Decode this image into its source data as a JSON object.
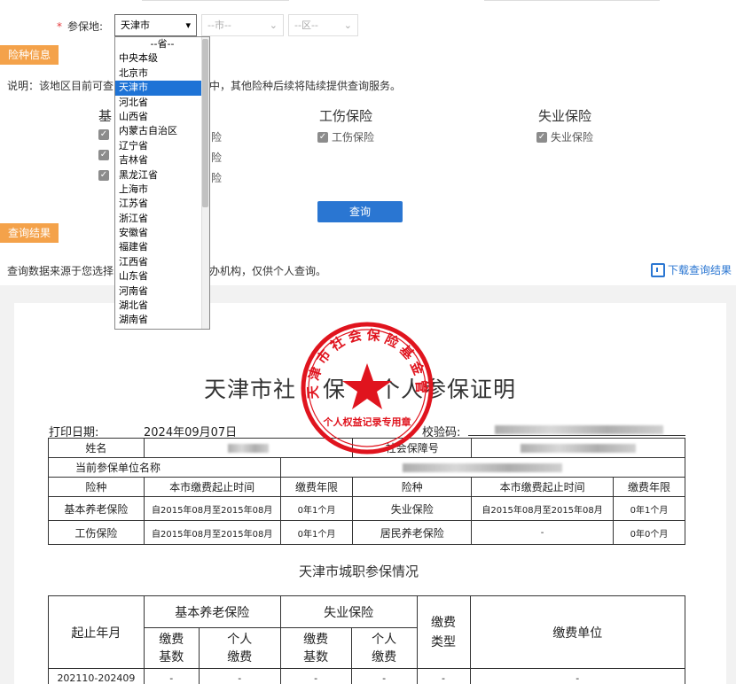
{
  "region": {
    "label": "参保地:",
    "required_mark": "*",
    "province_value": "天津市",
    "city_placeholder": "--市--",
    "district_placeholder": "--区--"
  },
  "province_options": [
    "--省--",
    "中央本级",
    "北京市",
    "天津市",
    "河北省",
    "山西省",
    "内蒙古自治区",
    "辽宁省",
    "吉林省",
    "黑龙江省",
    "上海市",
    "江苏省",
    "浙江省",
    "安徽省",
    "福建省",
    "江西省",
    "山东省",
    "河南省",
    "湖北省",
    "湖南省"
  ],
  "selected_option": "天津市",
  "insurance": {
    "tag": "险种信息",
    "note_prefix": "说明：该地区目前可查",
    "note_suffix": "中，其他险种后续将陆续提供查询服务。",
    "groups": [
      {
        "title": "基",
        "items": [
          "",
          "",
          ""
        ]
      },
      {
        "title": "工伤保险",
        "items": [
          "工伤保险"
        ]
      },
      {
        "title": "失业保险",
        "items": [
          "失业保险"
        ]
      }
    ],
    "partial_items": [
      "险",
      "险",
      "险"
    ],
    "query_button": "查询"
  },
  "result": {
    "tag": "查询结果",
    "note_prefix": "查询数据来源于您选择",
    "note_suffix": "办机构，仅供个人查询。",
    "download_label": "下载查询结果"
  },
  "certificate": {
    "title_a": "天津市社",
    "title_b": "保",
    "title_c": "个",
    "title_d": "人参保证明",
    "print_label": "打印日期:",
    "print_date": "2024年09月07日",
    "verify_label": "校验码:",
    "name_label": "姓名",
    "ssn_label": "社会保障号",
    "unit_label": "当前参保单位名称",
    "col_type": "险种",
    "col_period": "本市缴费起止时间",
    "col_years": "缴费年限",
    "rows": [
      {
        "type_a": "基本养老保险",
        "period_a": "自2015年08月至2015年08月",
        "years_a": "0年1个月",
        "type_b": "失业保险",
        "period_b": "自2015年08月至2015年08月",
        "years_b": "0年1个月"
      },
      {
        "type_a": "工伤保险",
        "period_a": "自2015年08月至2015年08月",
        "years_a": "0年1个月",
        "type_b": "居民养老保险",
        "period_b": "-",
        "years_b": "0年0个月"
      }
    ],
    "sub_title": "天津市城职参保情况",
    "detail": {
      "col_period": "起止年月",
      "col_pension": "基本养老保险",
      "col_unemployment": "失业保险",
      "col_pay_type": "缴费类型",
      "col_unit": "缴费单位",
      "col_base": "缴费基数",
      "col_personal": "个人缴费",
      "first_row_period": "202110-202409",
      "dash": "-"
    },
    "seal": {
      "outer_text": "天津市社会保险基金管理中心",
      "inner_text": "个人权益记录专用章",
      "color": "#e0141e"
    }
  }
}
